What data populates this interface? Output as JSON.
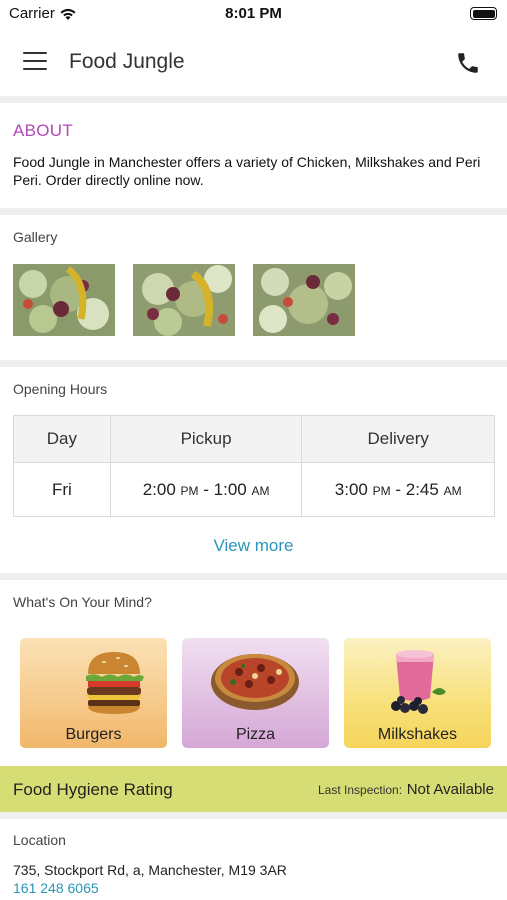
{
  "status_bar": {
    "carrier": "Carrier",
    "time": "8:01 PM"
  },
  "header": {
    "title": "Food Jungle",
    "menu_icon": "hamburger-menu-icon",
    "phone_icon": "phone-icon"
  },
  "about": {
    "title": "ABOUT",
    "text": "Food Jungle in Manchester offers a variety of Chicken, Milkshakes and  Peri Peri. Order directly online now."
  },
  "gallery": {
    "title": "Gallery",
    "image_count": 3
  },
  "opening_hours": {
    "title": "Opening Hours",
    "headers": [
      "Day",
      "Pickup",
      "Delivery"
    ],
    "rows": [
      {
        "day": "Fri",
        "pickup_open": "2:00",
        "pickup_open_ampm": "PM",
        "pickup_close": "1:00",
        "pickup_close_ampm": "AM",
        "delivery_open": "3:00",
        "delivery_open_ampm": "PM",
        "delivery_close": "2:45",
        "delivery_close_ampm": "AM"
      }
    ],
    "dash": "-",
    "view_more": "View more"
  },
  "mind": {
    "title": "What's On Your Mind?",
    "categories": [
      {
        "label": "Burgers",
        "color": "#f4c27d"
      },
      {
        "label": "Pizza",
        "color": "#dcb8dd"
      },
      {
        "label": "Milkshakes",
        "color": "#f7dc6c"
      }
    ]
  },
  "hygiene": {
    "title": "Food Hygiene Rating",
    "inspection_label": "Last Inspection:",
    "inspection_value": "Not Available",
    "bar_color": "#d6dd75"
  },
  "location": {
    "title": "Location",
    "address": "735, Stockport Rd, a, Manchester, M19 3AR",
    "phone": "161 248 6065"
  },
  "colors": {
    "accent_purple": "#b048b5",
    "link_blue": "#2a95b8",
    "separator": "#efefef"
  }
}
